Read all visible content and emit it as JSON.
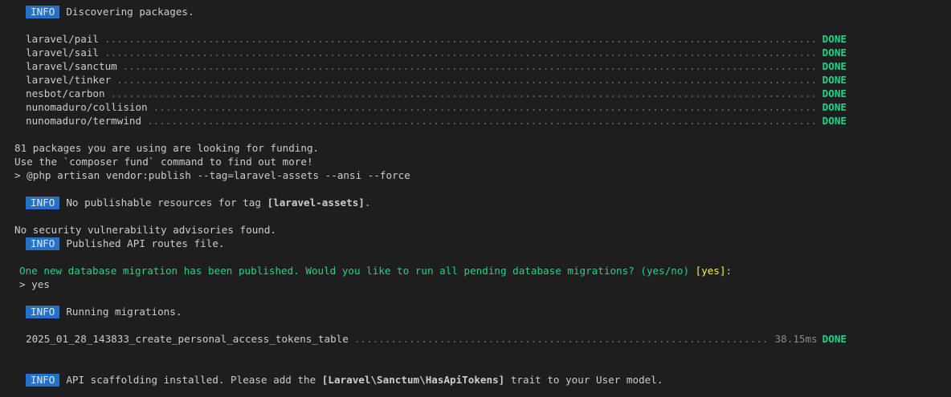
{
  "discover": {
    "badge": "INFO",
    "text": "Discovering packages."
  },
  "packages": [
    {
      "name": "laravel/pail",
      "status": "DONE"
    },
    {
      "name": "laravel/sail",
      "status": "DONE"
    },
    {
      "name": "laravel/sanctum",
      "status": "DONE"
    },
    {
      "name": "laravel/tinker",
      "status": "DONE"
    },
    {
      "name": "nesbot/carbon",
      "status": "DONE"
    },
    {
      "name": "nunomaduro/collision",
      "status": "DONE"
    },
    {
      "name": "nunomaduro/termwind",
      "status": "DONE"
    }
  ],
  "funding": {
    "line1": "81 packages you are using are looking for funding.",
    "line2": "Use the `composer fund` command to find out more!"
  },
  "command": "> @php artisan vendor:publish --tag=laravel-assets --ansi --force",
  "no_publishable": {
    "badge": "INFO",
    "text_before": "No publishable resources for tag ",
    "tag": "[laravel-assets]",
    "text_after": "."
  },
  "security": "No security vulnerability advisories found.",
  "published": {
    "badge": "INFO",
    "text": "Published API routes file."
  },
  "prompt": {
    "question": "One new database migration has been published. Would you like to run all pending database migrations? (yes/no)",
    "default": "[yes]",
    "colon": ":",
    "answer": "> yes"
  },
  "running": {
    "badge": "INFO",
    "text": "Running migrations."
  },
  "migration": {
    "name": "2025_01_28_143833_create_personal_access_tokens_table",
    "time": "38.15ms",
    "status": "DONE"
  },
  "scaffold": {
    "badge": "INFO",
    "text_before": "API scaffolding installed. Please add the ",
    "trait": "[Laravel\\Sanctum\\HasApiTokens]",
    "text_after": " trait to your User model."
  },
  "colors": {
    "background": "#1e1e1e",
    "info_badge": "#2472c8",
    "done": "#23d18b",
    "prompt": "#23d18b",
    "default_answer": "#f5f543"
  }
}
